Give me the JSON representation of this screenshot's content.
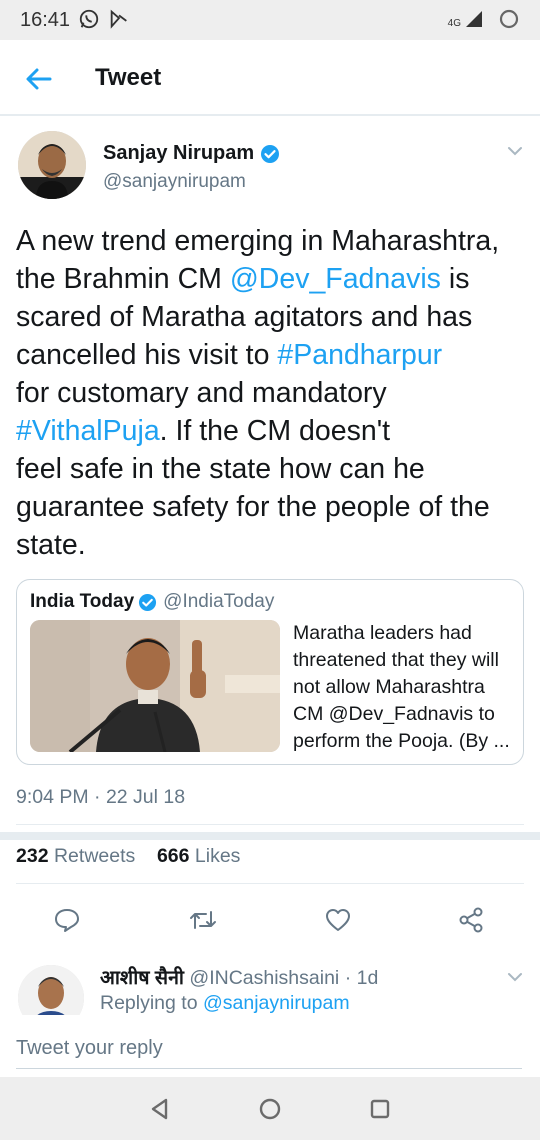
{
  "status_bar": {
    "time": "16:41",
    "network": "4G"
  },
  "header": {
    "title": "Tweet"
  },
  "tweet": {
    "author_name": "Sanjay Nirupam",
    "author_handle": "@sanjaynirupam",
    "text_lines": [
      [
        {
          "t": "A new trend emerging in Maharashtra,"
        }
      ],
      [
        {
          "t": "the Brahmin CM "
        },
        {
          "t": "@Dev_Fadnavis",
          "link": true
        },
        {
          "t": " is"
        }
      ],
      [
        {
          "t": "scared of Maratha agitators and has"
        }
      ],
      [
        {
          "t": "cancelled his visit to "
        },
        {
          "t": "#Pandharpur",
          "link": true
        }
      ],
      [
        {
          "t": "for customary and mandatory"
        }
      ],
      [
        {
          "t": "#VithalPuja",
          "link": true
        },
        {
          "t": ". If the CM doesn't"
        }
      ],
      [
        {
          "t": "feel safe in the state how can he"
        }
      ],
      [
        {
          "t": "guarantee safety for the people of the"
        }
      ],
      [
        {
          "t": "state."
        }
      ]
    ],
    "timestamp": "9:04 PM · 22 Jul 18",
    "retweets_count": "232",
    "retweets_label": "Retweets",
    "likes_count": "666",
    "likes_label": "Likes"
  },
  "quoted_tweet": {
    "name": "India Today",
    "handle": "@IndiaToday",
    "text_lines": [
      "Maratha leaders had",
      "threatened that they will",
      "not allow Maharashtra",
      "CM @Dev_Fadnavis to",
      "perform the Pooja. (By ..."
    ]
  },
  "reply": {
    "name": "आशीष सैनी",
    "handle": "@INCashishsaini",
    "age": "· 1d",
    "replying_prefix": "Replying to",
    "replying_to": "@sanjaynirupam"
  },
  "reply_input": {
    "placeholder": "Tweet your reply"
  },
  "colors": {
    "link": "#1da1f2",
    "secondary_text": "#657786",
    "divider": "#e6ecf0"
  },
  "icons": {
    "back": "arrow-left-icon",
    "verified": "verified-badge-icon",
    "caret": "chevron-down-icon",
    "reply": "comment-icon",
    "retweet": "retweet-icon",
    "like": "heart-icon",
    "share": "share-icon"
  }
}
